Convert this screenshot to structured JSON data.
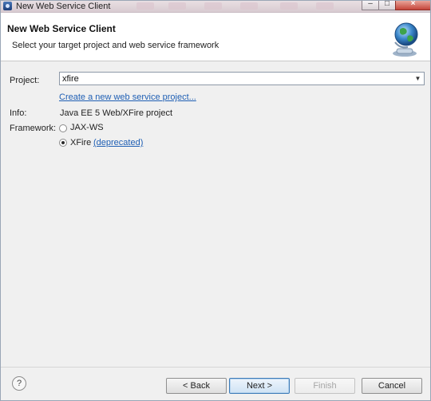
{
  "window": {
    "title": "New Web Service Client"
  },
  "header": {
    "title": "New Web Service Client",
    "description": "Select your target project and web service framework",
    "icon": "globe-wizard-icon"
  },
  "form": {
    "project_label": "Project:",
    "project_value": "xfire",
    "create_link": "Create a new web service project...",
    "info_label": "Info:",
    "info_value": "Java EE 5 Web/XFire project",
    "framework_label": "Framework:",
    "framework_options": [
      {
        "label": "JAX-WS",
        "selected": false
      },
      {
        "label": "XFire",
        "selected": true,
        "note": "(deprecated)"
      }
    ]
  },
  "footer": {
    "help_glyph": "?",
    "back_label": "< Back",
    "next_label": "Next >",
    "finish_label": "Finish",
    "cancel_label": "Cancel"
  }
}
